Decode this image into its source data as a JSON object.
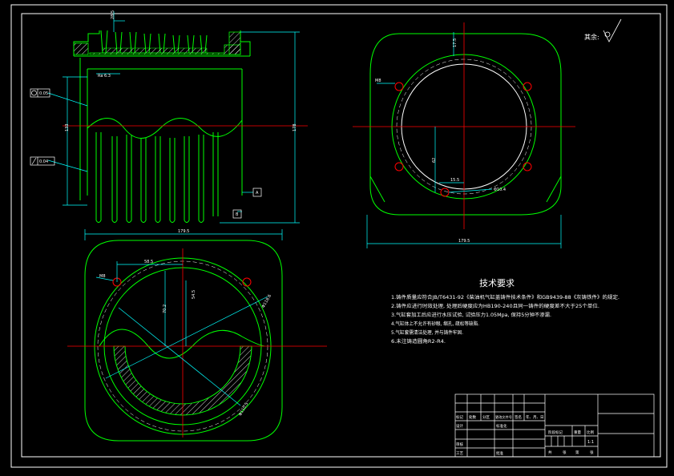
{
  "roughness_label": "其余:",
  "side_view": {
    "ra_mark": "Ra 6.3",
    "top_dim": "28.5",
    "height_dim": "178",
    "inner_dim": "133",
    "fcf_1": "0.05",
    "fcf_2": "0.04",
    "datum_a": "A",
    "datum_b": "B"
  },
  "top_view": {
    "width_dim": "179.5",
    "offset_dim": "58.5",
    "hole_dim": "M8",
    "dim_v1": "70.2",
    "dim_v2": "54.5",
    "pcd_dim": "Φ118.6",
    "bore_dim": "Φ110.5"
  },
  "right_view": {
    "width_dim": "179.5",
    "hole_dim": "M8",
    "v_dim": "62",
    "small_dim": "17.5",
    "h_dim": "15.5",
    "circle_dim": "Φ10.4"
  },
  "tech_title": "技术要求",
  "tech_items": [
    "1.铸件质量应符合JB/T6431-92《柴油机气缸盖铸件技术条件》和GB9439-88《灰铸铁件》的规定.",
    "2.铸件应进行时效处理, 处理后硬度应为HB190-240且同一铸件的硬度差不大于25个单位.",
    "3.气缸套加工后应进行水压试验, 试验压力1.05Mpa, 保持5分钟不渗漏.",
    "4.气缸体上不允许有砂眼, 缩孔, 疏松等缺陷.",
    "5.气缸套需清洁处理, 并与铸件牢固.",
    "6.未注铸造圆角R2-R4."
  ],
  "title_block": {
    "labels_row": [
      "标记",
      "处数",
      "分区",
      "更改文件号",
      "签名",
      "年、月、日"
    ],
    "design": "设计",
    "standard": "标准化",
    "review": "审核",
    "process": "工艺",
    "approve": "批准",
    "stage_mark": "阶段标记",
    "weight": "重量",
    "ratio": "比例",
    "scale": "1:1",
    "sheets": [
      "共",
      "张",
      "第",
      "张"
    ]
  }
}
